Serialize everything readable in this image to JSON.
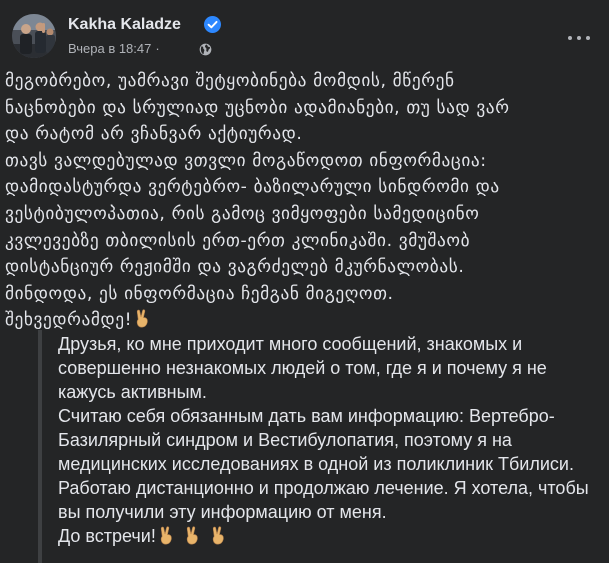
{
  "post": {
    "author": "Kakha Kaladze",
    "timestamp": "Вчера в 18:47",
    "separator": "·",
    "audience_icon": "globe-icon",
    "verified_icon": "verified-badge-icon",
    "more_icon": "more-options-icon",
    "georgian_lines": [
      "მეგობრებო, უამრავი შეტყობინება მომდის, მწერენ",
      "ნაცნობები და სრულიად უცნობი ადამიანები, თუ სად ვარ",
      "და რატომ არ ვჩანვარ აქტიურად.",
      "თავს ვალდებულად ვთვლი მოგაწოდოთ ინფორმაცია:",
      "დამიდასტურდა ვერტებრო- ბაზილარული სინდრომი და",
      "ვესტიბულოპათია, რის გამოც ვიმყოფები სამედიცინო",
      "კვლევებზე თბილისის ერთ-ერთ კლინიკაში. ვმუშაობ",
      "დისტანციურ რეჟიმში და ვაგრძელებ მკურნალობას.",
      "მინდოდა, ეს ინფორმაცია ჩემგან მიგეღოთ.",
      "შეხვედრამდე!"
    ],
    "russian_lines": [
      "Друзья, ко мне приходит много сообщений, знакомых и",
      "совершенно незнакомых людей о том, где я и почему я не",
      "кажусь активным.",
      "Считаю себя обязанным дать вам информацию: Вертебро-",
      "Базилярный синдром и Вестибулопатия, поэтому я на",
      "медицинских исследованиях в одной из поликлиник Тбилиси.",
      "Работаю дистанционно и продолжаю лечение. Я хотела, чтобы",
      "вы получили эту информацию от меня.",
      "До встречи!"
    ],
    "emoji_icon": "victory-hand-emoji"
  },
  "colors": {
    "background": "#242526",
    "text_primary": "#e4e6eb",
    "text_secondary": "#b0b3b8",
    "verified_blue": "#2d88ff",
    "quote_bar": "#3e4042"
  }
}
